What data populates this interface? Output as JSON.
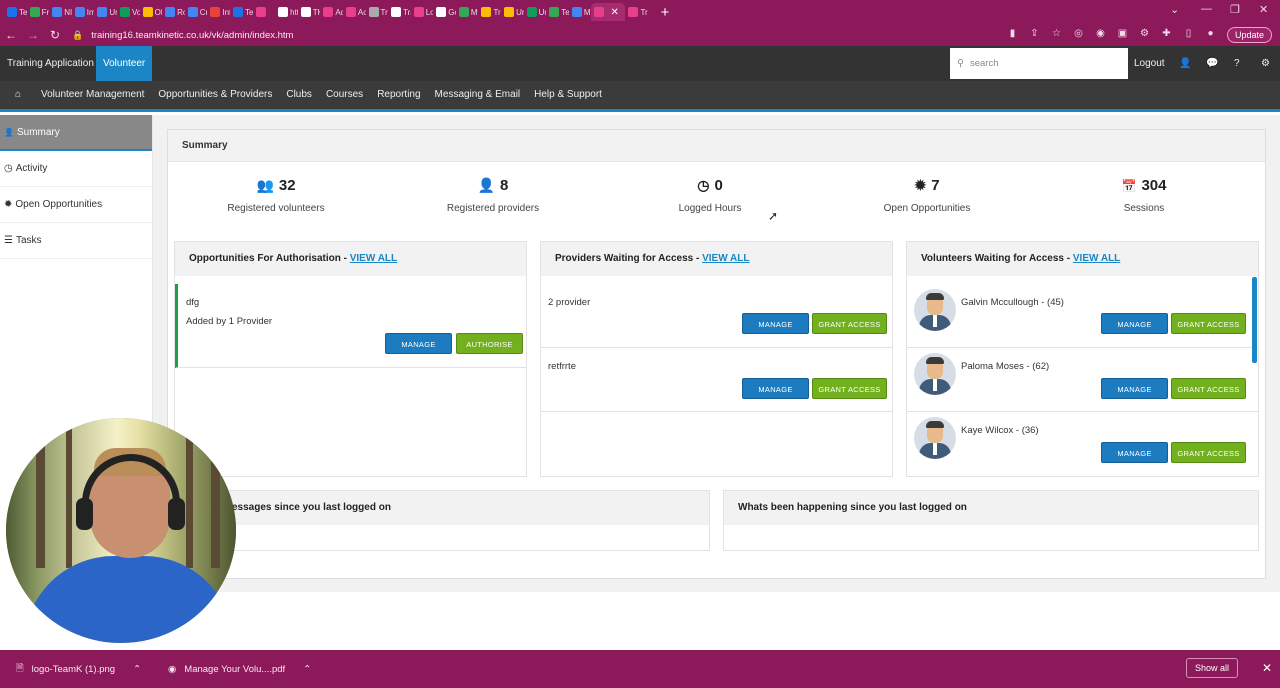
{
  "browser": {
    "tab_labels": [
      "Te",
      "Fre",
      "NI",
      "Im",
      "Un",
      "Vo",
      "OL",
      "Ro",
      "Cri",
      "Int",
      "Te",
      "",
      "htt",
      "TK",
      "Ac",
      "Ac",
      "Tra",
      "Tra",
      "Lo",
      "Go",
      "My",
      "Tra",
      "Un",
      "Ur",
      "Te",
      "Mi",
      "",
      "Tra"
    ],
    "tab_colors": [
      "#1a73e8",
      "#34a853",
      "#4285f4",
      "#4285f4",
      "#4285f4",
      "#0f9d58",
      "#fbbc04",
      "#4285f4",
      "#4285f4",
      "#ea4335",
      "#1a73e8",
      "#e83e8c",
      "#ffffff",
      "#ffffff",
      "#e83e8c",
      "#e83e8c",
      "#aaaaaa",
      "#ffffff",
      "#e83e8c",
      "#ffffff",
      "#34a853",
      "#fbbc04",
      "#fbbc04",
      "#0f9d58",
      "#34a853",
      "#4285f4",
      "#e83e8c",
      "#e83e8c"
    ],
    "active_tab_index": 26,
    "new_tab": "+",
    "url": "training16.teamkinetic.co.uk/vk/admin/index.htm",
    "update_label": "Update",
    "accent": "#8c1a5a"
  },
  "header": {
    "app_training": "Training Application",
    "app_volunteer": "Volunteer",
    "search_placeholder": "search",
    "logout": "Logout"
  },
  "menu": [
    "Volunteer Management",
    "Opportunities & Providers",
    "Clubs",
    "Courses",
    "Reporting",
    "Messaging & Email",
    "Help & Support"
  ],
  "sidebar": [
    {
      "label": "Summary",
      "icon": "user-icon",
      "glyph": "👤"
    },
    {
      "label": "Activity",
      "icon": "clock-icon",
      "glyph": "◷"
    },
    {
      "label": "Open Opportunities",
      "icon": "badge-icon",
      "glyph": "✹"
    },
    {
      "label": "Tasks",
      "icon": "list-icon",
      "glyph": "☰"
    }
  ],
  "summary": {
    "title": "Summary",
    "stats": [
      {
        "value": "32",
        "label": "Registered volunteers",
        "icon": "users-icon",
        "glyph": "👥"
      },
      {
        "value": "8",
        "label": "Registered providers",
        "icon": "user-icon",
        "glyph": "👤"
      },
      {
        "value": "0",
        "label": "Logged Hours",
        "icon": "clock-icon",
        "glyph": "◷"
      },
      {
        "value": "7",
        "label": "Open Opportunities",
        "icon": "badge-icon",
        "glyph": "✹"
      },
      {
        "value": "304",
        "label": "Sessions",
        "icon": "calendar-icon",
        "glyph": "📅"
      }
    ]
  },
  "opportunities": {
    "title": "Opportunities For Authorisation - ",
    "view_all": "VIEW ALL",
    "item_name": "dfg",
    "item_sub": "Added by 1 Provider",
    "manage": "MANAGE",
    "authorise": "AUTHORISE"
  },
  "providers": {
    "title": "Providers Waiting for Access - ",
    "view_all": "VIEW ALL",
    "items": [
      "2 provider",
      "retfrrte"
    ],
    "manage": "MANAGE",
    "grant": "GRANT ACCESS"
  },
  "volunteers": {
    "title": "Volunteers Waiting for Access - ",
    "view_all": "VIEW ALL",
    "items": [
      "Galvin Mccullough - (45)",
      "Paloma Moses - (62)",
      "Kaye Wilcox - (36)"
    ],
    "manage": "MANAGE",
    "grant": "GRANT ACCESS"
  },
  "messages_title": "essages since you last logged on",
  "happening_title": "Whats been happening since you last logged on",
  "downloads": {
    "items": [
      "logo-TeamK (1).png",
      "Manage Your Volu....pdf"
    ],
    "show_all": "Show all"
  }
}
